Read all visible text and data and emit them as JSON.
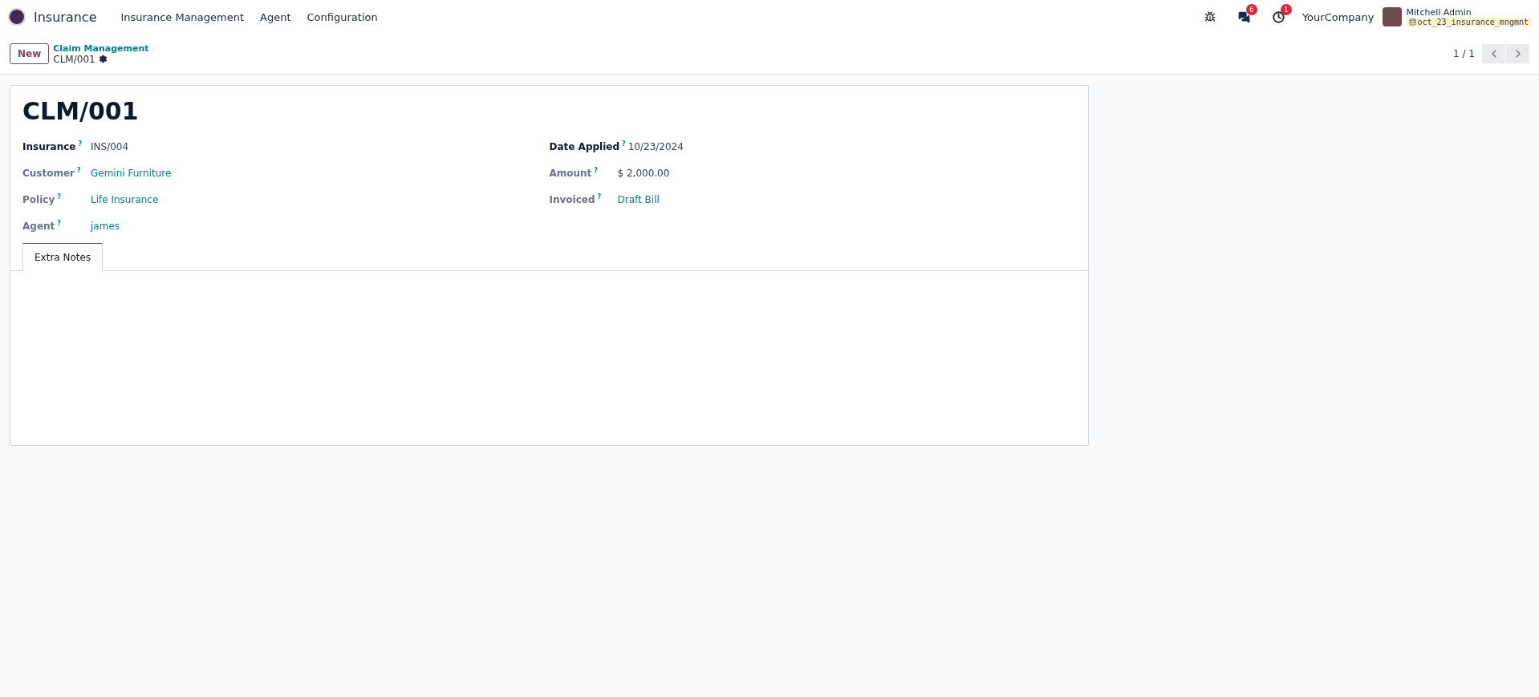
{
  "navbar": {
    "app_name": "Insurance",
    "menus": [
      "Insurance Management",
      "Agent",
      "Configuration"
    ],
    "messages_count": "6",
    "activities_count": "1",
    "company": "YourCompany",
    "user_name": "Mitchell Admin",
    "database": "oct_23_insurance_mngmnt"
  },
  "control_panel": {
    "new_button": "New",
    "breadcrumb_parent": "Claim Management",
    "breadcrumb_current": "CLM/001",
    "pager": "1 / 1"
  },
  "record": {
    "title": "CLM/001",
    "left_fields": [
      {
        "label": "Insurance",
        "help": "?",
        "value": "INS/004",
        "required": true,
        "kind": "text"
      },
      {
        "label": "Customer",
        "help": "?",
        "value": "Gemini Furniture",
        "required": false,
        "kind": "link"
      },
      {
        "label": "Policy",
        "help": "?",
        "value": "Life Insurance",
        "required": false,
        "kind": "link"
      },
      {
        "label": "Agent",
        "help": "?",
        "value": "james",
        "required": false,
        "kind": "link"
      }
    ],
    "right_fields": [
      {
        "label": "Date Applied",
        "help": "?",
        "value": "10/23/2024",
        "required": true,
        "kind": "text"
      },
      {
        "label": "Amount",
        "help": "?",
        "value": "$ 2,000.00",
        "required": false,
        "kind": "text"
      },
      {
        "label": "Invoiced",
        "help": "?",
        "value": "Draft Bill",
        "required": false,
        "kind": "link"
      }
    ],
    "tabs": [
      {
        "label": "Extra Notes",
        "selected": true
      }
    ]
  }
}
